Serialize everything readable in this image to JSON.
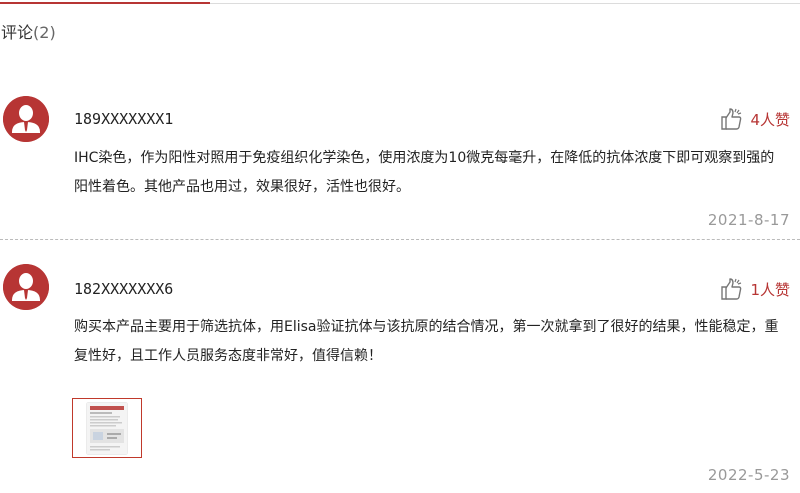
{
  "section": {
    "title": "评论",
    "count": "(2)"
  },
  "colors": {
    "accent": "#b73534",
    "date": "#999999",
    "text": "#222222"
  },
  "comments": [
    {
      "user": "189XXXXXXX1",
      "avatar_icon": "user-avatar-icon",
      "like_icon": "thumbs-up-icon",
      "likes": "4人赞",
      "lines": [
        "IHC染色，作为阳性对照用于免疫组织化学染色，使用浓度为10微克每毫升，在降低的抗体浓度下即可观察到强的",
        "阳性着色。其他产品也用过，效果很好，活性也很好。"
      ],
      "date": "2021-8-17"
    },
    {
      "user": "182XXXXXXX6",
      "avatar_icon": "user-avatar-icon",
      "like_icon": "thumbs-up-icon",
      "likes": "1人赞",
      "lines": [
        "购买本产品主要用于筛选抗体，用Elisa验证抗体与该抗原的结合情况，第一次就拿到了很好的结果，性能稳定，重",
        "复性好，且工作人员服务态度非常好，值得信赖！"
      ],
      "attachment_icon": "document-thumbnail-icon",
      "date": "2022-5-23"
    }
  ]
}
